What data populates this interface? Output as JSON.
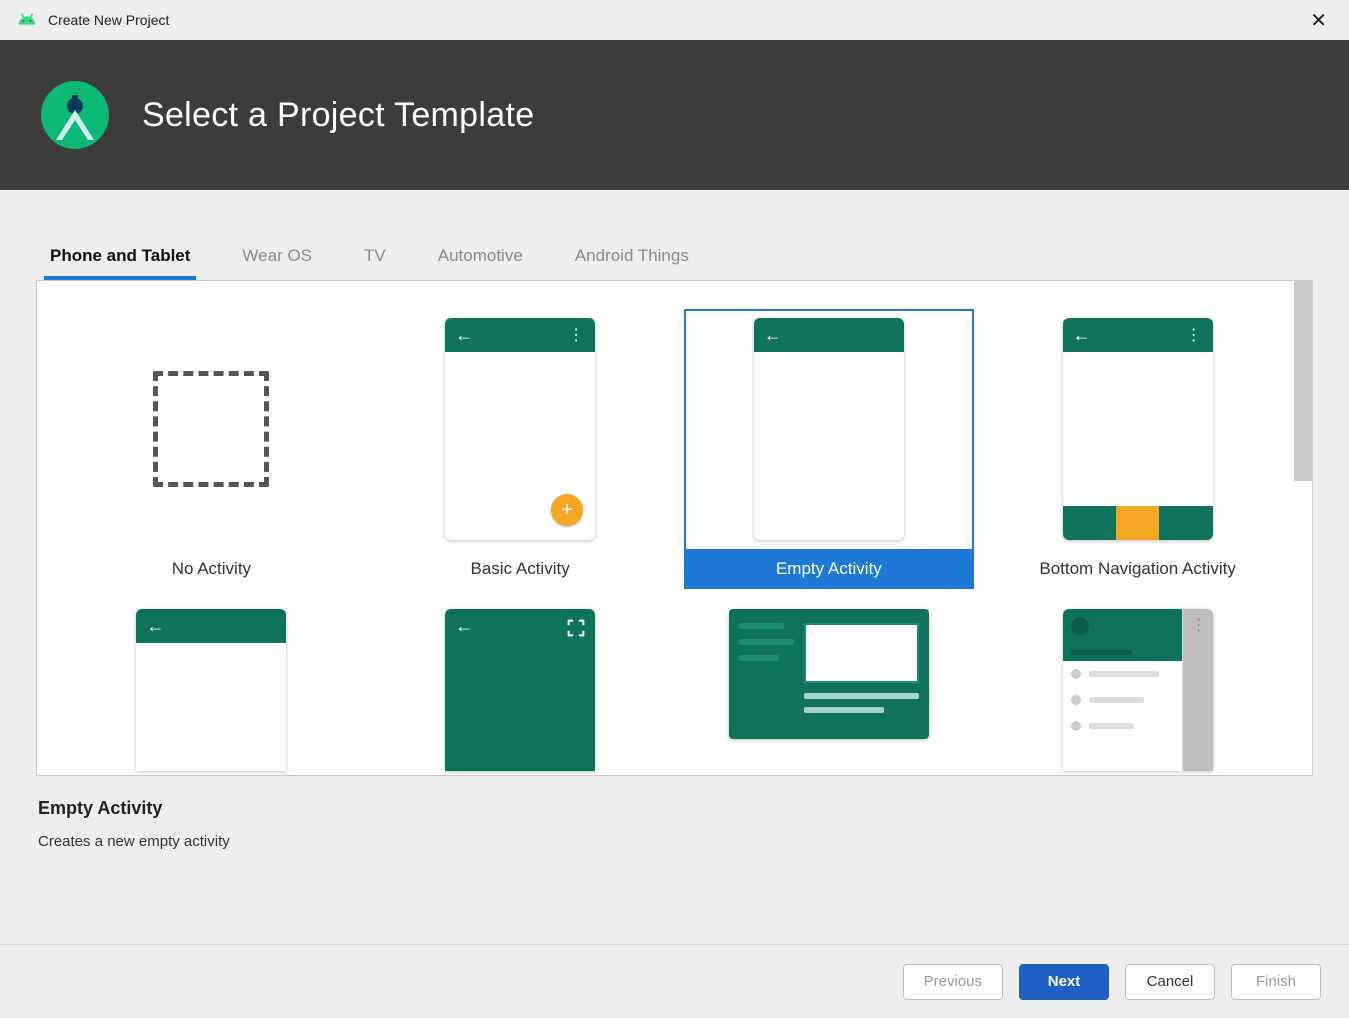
{
  "window": {
    "title": "Create New Project"
  },
  "header": {
    "title": "Select a Project Template"
  },
  "tabs": [
    {
      "label": "Phone and Tablet",
      "active": true
    },
    {
      "label": "Wear OS",
      "active": false
    },
    {
      "label": "TV",
      "active": false
    },
    {
      "label": "Automotive",
      "active": false
    },
    {
      "label": "Android Things",
      "active": false
    }
  ],
  "templates": [
    {
      "label": "No Activity",
      "selected": false
    },
    {
      "label": "Basic Activity",
      "selected": false
    },
    {
      "label": "Empty Activity",
      "selected": true
    },
    {
      "label": "Bottom Navigation Activity",
      "selected": false
    }
  ],
  "description": {
    "title": "Empty Activity",
    "text": "Creates a new empty activity"
  },
  "buttons": {
    "previous": "Previous",
    "next": "Next",
    "cancel": "Cancel",
    "finish": "Finish"
  },
  "colors": {
    "accent": "#1e79d6",
    "primaryBtn": "#1e5fc3",
    "teal": "#0f725d",
    "amber": "#f5a623",
    "headerBg": "#3c3c3c"
  }
}
